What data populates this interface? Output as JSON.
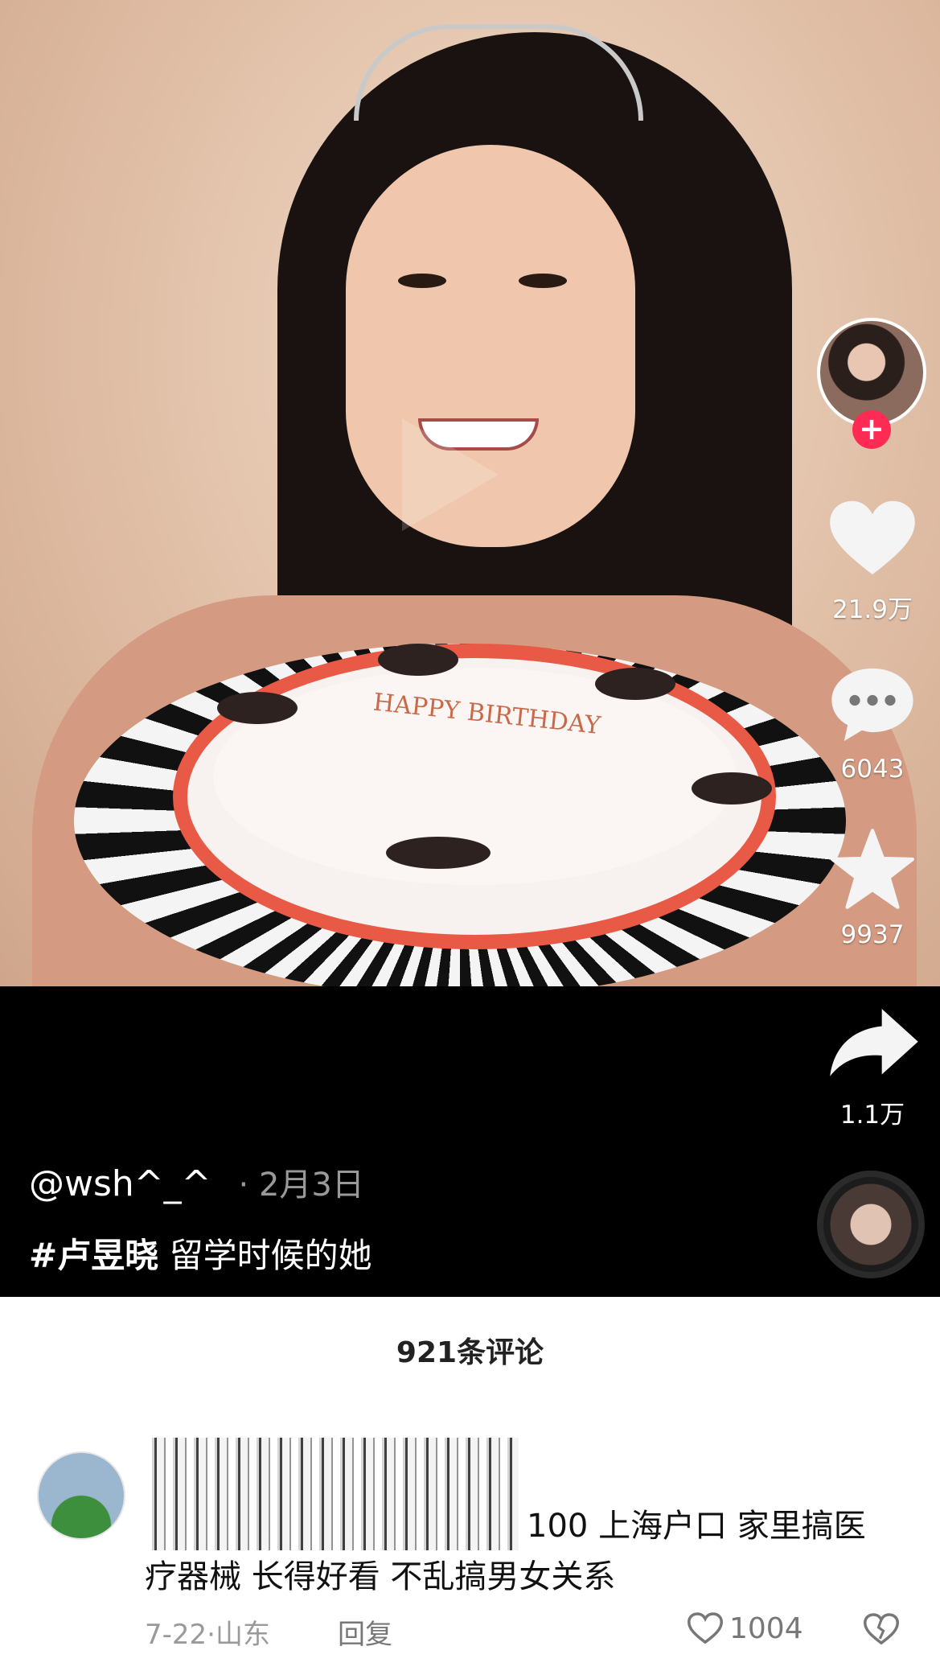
{
  "video": {
    "author_handle": "@wsh^_^",
    "separator": "·",
    "date": "2月3日",
    "hashtag": "#卢昱晓",
    "caption": "留学时候的她",
    "cake_text": "HAPPY BIRTHDAY"
  },
  "actions": {
    "follow_symbol": "+",
    "likes": "21.9万",
    "comments": "6043",
    "favorites": "9937",
    "shares": "1.1万"
  },
  "comments_panel": {
    "title": "921条评论",
    "items": [
      {
        "text_line1": "100 上海户口 家里搞医",
        "text_line2": "疗器械 长得好看 不乱搞男女关系",
        "date": "7-22",
        "location": "山东",
        "reply_label": "回复",
        "like_count": "1004"
      }
    ]
  },
  "colors": {
    "follow": "#fe2c55",
    "background_video": "#000000",
    "panel": "#ffffff"
  }
}
